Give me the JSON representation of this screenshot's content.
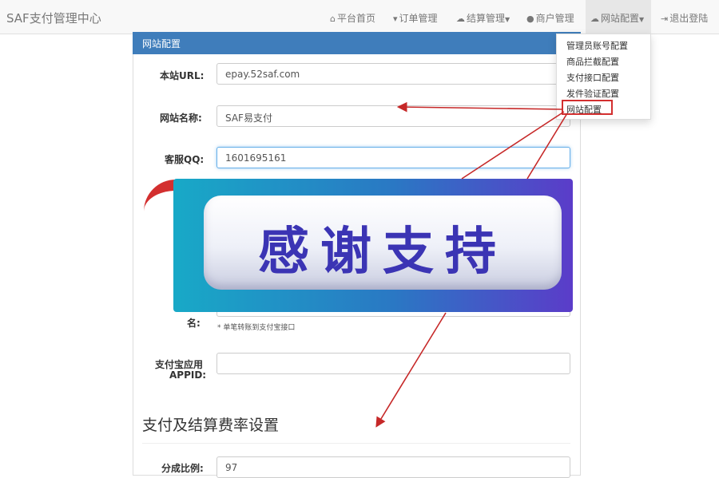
{
  "navbar": {
    "brand": "SAF支付管理中心",
    "items": [
      {
        "label": "平台首页",
        "icon": "home-icon"
      },
      {
        "label": "订单管理",
        "icon": "cart-icon"
      },
      {
        "label": "结算管理",
        "icon": "cloud-icon"
      },
      {
        "label": "商户管理",
        "icon": "user-icon"
      },
      {
        "label": "网站配置",
        "icon": "cloud-icon"
      },
      {
        "label": "退出登陆",
        "icon": "logout-icon"
      }
    ]
  },
  "dropdown": {
    "items": [
      "管理员账号配置",
      "商品拦截配置",
      "支付接口配置",
      "发件验证配置",
      "网站配置"
    ]
  },
  "panel": {
    "title": "网站配置",
    "fields": [
      {
        "label": "本站URL:",
        "value": "epay.52saf.com"
      },
      {
        "label": "网站名称:",
        "value": "SAF易支付"
      },
      {
        "label": "客服QQ:",
        "value": "1601695161"
      }
    ],
    "partial_label": "名:",
    "hint": "* 单笔转账到支付宝接口",
    "appid_label_line1": "支付宝应用",
    "appid_label_line2": "APPID:",
    "appid_value": "",
    "section_title": "支付及结算费率设置",
    "rate_label": "分成比例:",
    "rate_value": "97"
  },
  "banner": {
    "text": "感谢支持"
  },
  "colors": {
    "panel_header": "#3f7dbb",
    "arrow": "#c62828",
    "banner_text": "#3b34b4"
  }
}
